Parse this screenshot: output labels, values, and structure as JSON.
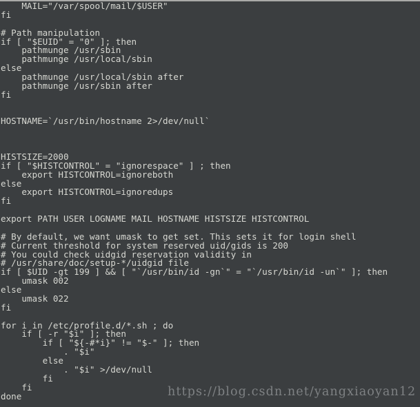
{
  "terminal": {
    "colors": {
      "background": "#3b3e40",
      "foreground": "#d7d8d2",
      "top_border": "#a9aaa8",
      "watermark": "#7e8183"
    },
    "lines": [
      "    MAIL=\"/var/spool/mail/$USER\"",
      "fi",
      "",
      "# Path manipulation",
      "if [ \"$EUID\" = \"0\" ]; then",
      "    pathmunge /usr/sbin",
      "    pathmunge /usr/local/sbin",
      "else",
      "    pathmunge /usr/local/sbin after",
      "    pathmunge /usr/sbin after",
      "fi",
      "",
      "",
      "HOSTNAME=`/usr/bin/hostname 2>/dev/null`",
      "",
      "",
      "",
      "HISTSIZE=2000",
      "if [ \"$HISTCONTROL\" = \"ignorespace\" ] ; then",
      "    export HISTCONTROL=ignoreboth",
      "else",
      "    export HISTCONTROL=ignoredups",
      "fi",
      "",
      "export PATH USER LOGNAME MAIL HOSTNAME HISTSIZE HISTCONTROL",
      "",
      "# By default, we want umask to get set. This sets it for login shell",
      "# Current threshold for system reserved uid/gids is 200",
      "# You could check uidgid reservation validity in",
      "# /usr/share/doc/setup-*/uidgid file",
      "if [ $UID -gt 199 ] && [ \"`/usr/bin/id -gn`\" = \"`/usr/bin/id -un`\" ]; then",
      "    umask 002",
      "else",
      "    umask 022",
      "fi",
      "",
      "for i in /etc/profile.d/*.sh ; do",
      "    if [ -r \"$i\" ]; then",
      "        if [ \"${-#*i}\" != \"$-\" ]; then",
      "            . \"$i\"",
      "        else",
      "            . \"$i\" >/dev/null",
      "        fi",
      "    fi",
      "done"
    ]
  },
  "watermark": {
    "text": "https://blog.csdn.net/yangxiaoyan12"
  }
}
